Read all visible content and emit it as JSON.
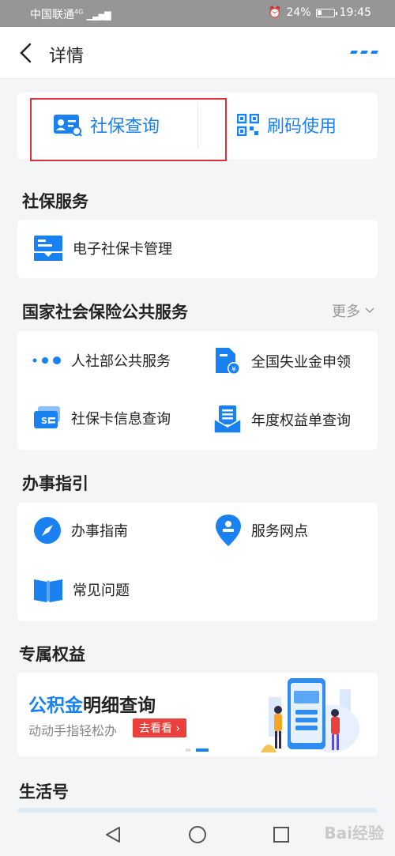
{
  "status_bar": {
    "carrier": "中国联通",
    "network": "4G",
    "battery_pct": "24%",
    "time": "19:45"
  },
  "header": {
    "title": "详情"
  },
  "top_actions": {
    "social_query": "社保查询",
    "scan_code": "刷码使用"
  },
  "social_service": {
    "title": "社保服务",
    "items": [
      {
        "label": "电子社保卡管理",
        "icon": "card-manage-icon"
      }
    ]
  },
  "national": {
    "title": "国家社会保险公共服务",
    "more": "更多",
    "items": [
      {
        "label": "人社部公共服务",
        "icon": "dots-icon"
      },
      {
        "label": "全国失业金申领",
        "icon": "yuan-document-icon"
      },
      {
        "label": "社保卡信息查询",
        "icon": "si-card-icon"
      },
      {
        "label": "年度权益单查询",
        "icon": "envelope-doc-icon"
      }
    ]
  },
  "guide": {
    "title": "办事指引",
    "items": [
      {
        "label": "办事指南",
        "icon": "compass-icon"
      },
      {
        "label": "服务网点",
        "icon": "location-pin-icon"
      },
      {
        "label": "常见问题",
        "icon": "book-icon"
      }
    ]
  },
  "exclusive": {
    "title": "专属权益",
    "banner": {
      "title_highlight": "公积金",
      "title_rest": "明细查询",
      "subtitle": "动动手指轻松办",
      "button": "去看看 ›"
    }
  },
  "life": {
    "title": "生活号"
  },
  "watermark": "Bai经验",
  "colors": {
    "accent": "#1a82f0",
    "highlight_border": "#d9323b",
    "banner_button": "#e8413b"
  }
}
